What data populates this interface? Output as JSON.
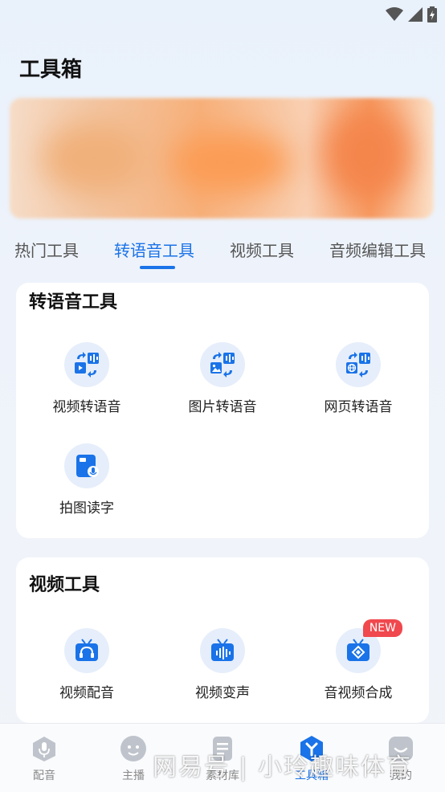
{
  "page": {
    "title": "工具箱"
  },
  "tabs": [
    "热门工具",
    "转语音工具",
    "视频工具",
    "音频编辑工具"
  ],
  "sections": {
    "speech": {
      "title": "转语音工具",
      "tools": [
        {
          "label": "视频转语音",
          "icon": "video-to-speech-icon"
        },
        {
          "label": "图片转语音",
          "icon": "image-to-speech-icon"
        },
        {
          "label": "网页转语音",
          "icon": "web-to-speech-icon"
        },
        {
          "label": "拍图读字",
          "icon": "photo-read-text-icon"
        }
      ]
    },
    "video": {
      "title": "视频工具",
      "tools": [
        {
          "label": "视频配音",
          "icon": "video-dubbing-icon"
        },
        {
          "label": "视频变声",
          "icon": "voice-change-icon"
        },
        {
          "label": "音视频合成",
          "icon": "av-merge-icon",
          "badge": "NEW"
        }
      ]
    }
  },
  "bottom_nav": [
    {
      "label": "配音",
      "icon": "dubbing-icon"
    },
    {
      "label": "主播",
      "icon": "anchor-icon"
    },
    {
      "label": "素材库",
      "icon": "library-icon"
    },
    {
      "label": "工具箱",
      "icon": "toolbox-icon",
      "active": true
    },
    {
      "label": "我的",
      "icon": "profile-icon"
    }
  ],
  "watermark": "网易号 | 小玲趣味体育",
  "colors": {
    "accent": "#1a73e8",
    "badge": "#f0484e",
    "icon_bg": "#e6eefb"
  }
}
